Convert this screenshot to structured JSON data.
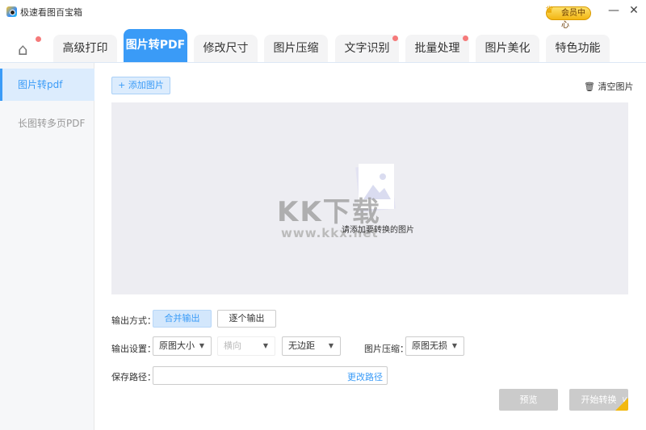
{
  "app": {
    "title": "极速看图百宝箱",
    "vip_label": "会员中心",
    "minimize": "—",
    "close": "✕"
  },
  "tabs": [
    {
      "label": "高级打印",
      "dot": false
    },
    {
      "label": "图片转PDF",
      "dot": false,
      "active": true
    },
    {
      "label": "修改尺寸",
      "dot": false
    },
    {
      "label": "图片压缩",
      "dot": false
    },
    {
      "label": "文字识别",
      "dot": true
    },
    {
      "label": "批量处理",
      "dot": true
    },
    {
      "label": "图片美化",
      "dot": false
    },
    {
      "label": "特色功能",
      "dot": false
    }
  ],
  "sidebar": {
    "items": [
      {
        "label": "图片转pdf",
        "active": true
      },
      {
        "label": "长图转多页PDF"
      }
    ]
  },
  "main": {
    "add_button": "+ 添加图片",
    "clear_button": "清空图片",
    "drop_hint": "请添加要转换的图片",
    "watermark": "KK下载",
    "watermark_url": "www.kkx.net",
    "output_mode_label": "输出方式：",
    "output_modes": [
      "合并输出",
      "逐个输出"
    ],
    "output_settings_label": "输出设置：",
    "size_select": "原图大小",
    "orientation_select": "横向",
    "margin_select": "无边距",
    "compress_label": "图片压缩：",
    "compress_select": "原图无损",
    "save_path_label": "保存路径：",
    "save_path_value": "",
    "change_path": "更改路径",
    "preview_button": "预览",
    "start_button": "开始转换",
    "vip_badge": "V"
  },
  "colors": {
    "accent": "#3a9bf7",
    "dot": "#f57a7a"
  }
}
